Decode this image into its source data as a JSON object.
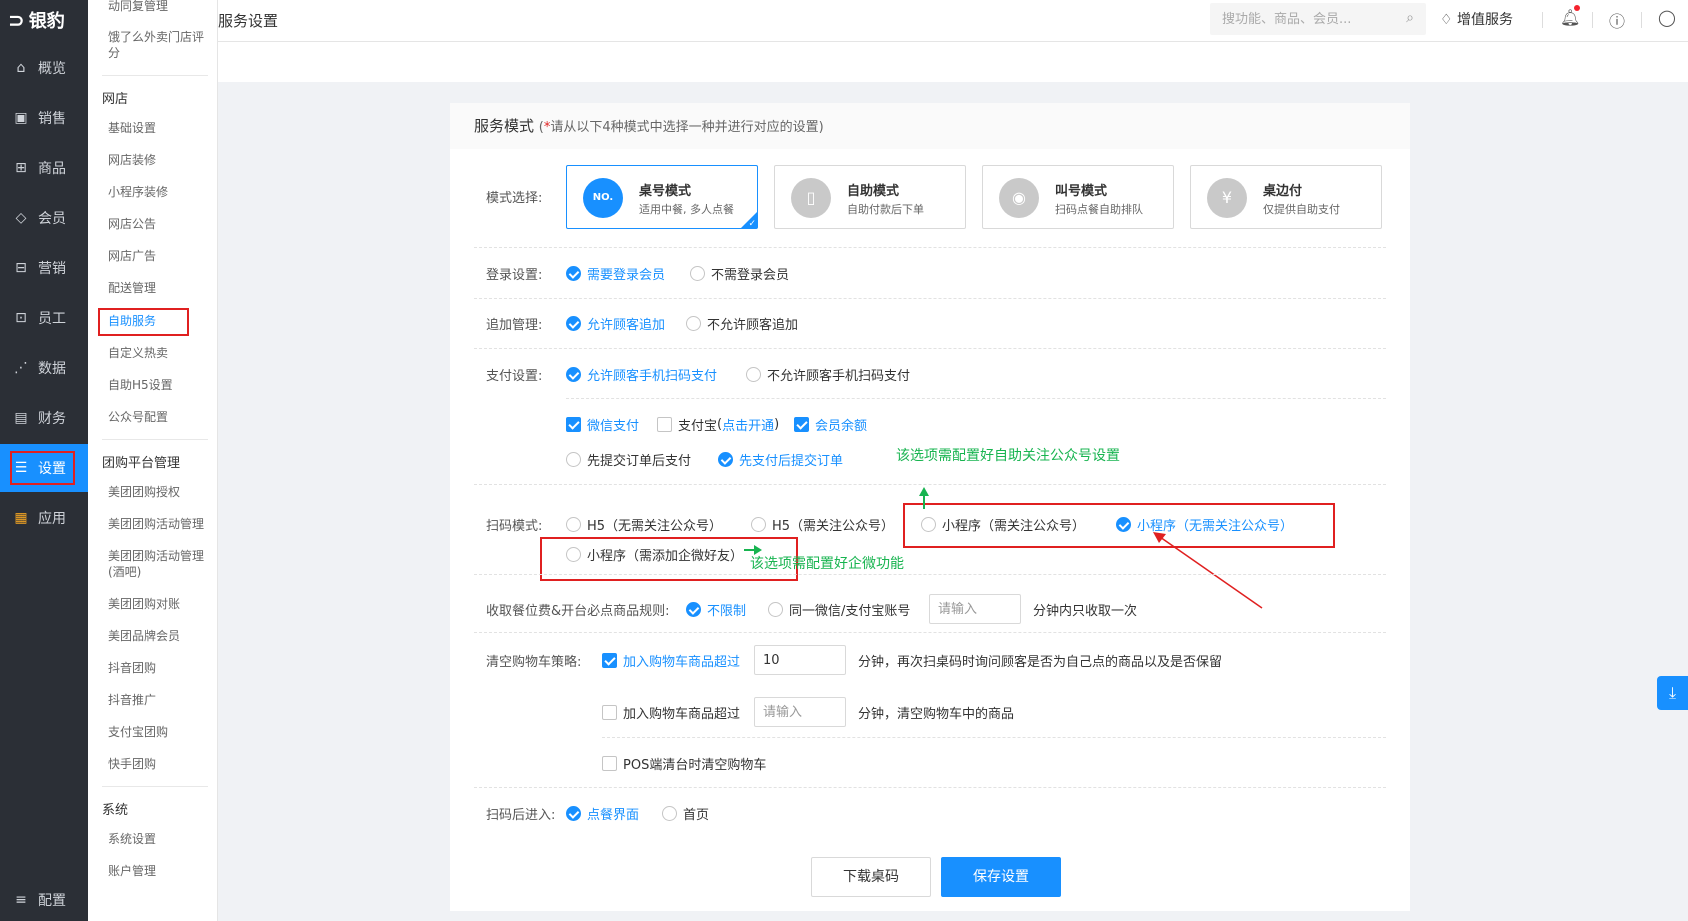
{
  "brand": {
    "name": "银豹",
    "mark": "⊃"
  },
  "nav": [
    {
      "key": "overview",
      "label": "概览",
      "icon": "home-icon",
      "glyph": "⌂"
    },
    {
      "key": "sales",
      "label": "销售",
      "icon": "sales-icon",
      "glyph": "▣"
    },
    {
      "key": "goods",
      "label": "商品",
      "icon": "goods-icon",
      "glyph": "⊞"
    },
    {
      "key": "member",
      "label": "会员",
      "icon": "member-icon",
      "glyph": "◇"
    },
    {
      "key": "marketing",
      "label": "营销",
      "icon": "marketing-icon",
      "glyph": "⊟"
    },
    {
      "key": "staff",
      "label": "员工",
      "icon": "staff-icon",
      "glyph": "⊡"
    },
    {
      "key": "data",
      "label": "数据",
      "icon": "data-icon",
      "glyph": "⋰"
    },
    {
      "key": "finance",
      "label": "财务",
      "icon": "finance-icon",
      "glyph": "▤"
    },
    {
      "key": "settings",
      "label": "设置",
      "icon": "settings-icon",
      "glyph": "☰"
    },
    {
      "key": "apps",
      "label": "应用",
      "icon": "apps-icon",
      "glyph": "▦"
    },
    {
      "key": "config",
      "label": "配置",
      "icon": "config-icon",
      "glyph": "≡"
    }
  ],
  "subnav": {
    "top_items": [
      "动同复管理",
      "饿了么外卖门店评分"
    ],
    "groups": [
      {
        "title": "网店",
        "items": [
          "基础设置",
          "网店装修",
          "小程序装修",
          "网店公告",
          "网店广告",
          "配送管理",
          "自助服务",
          "自定义热卖",
          "自助H5设置",
          "公众号配置"
        ]
      },
      {
        "title": "团购平台管理",
        "items": [
          "美团团购授权",
          "美团团购活动管理",
          "美团团购活动管理(酒吧)",
          "美团团购对账",
          "美团品牌会员",
          "抖音团购",
          "抖音推广",
          "支付宝团购",
          "快手团购"
        ]
      },
      {
        "title": "系统",
        "items": [
          "系统设置",
          "账户管理"
        ]
      }
    ]
  },
  "header": {
    "title": "服务设置",
    "search_placeholder": "搜功能、商品、会员...",
    "value_added": "增值服务"
  },
  "card": {
    "title": "服务模式",
    "note_star": "*",
    "note": "请从以下4种模式中选择一种并进行对应的设置)",
    "note_open": "(",
    "mode_label": "模式选择:",
    "modes": [
      {
        "title": "桌号模式",
        "sub": "适用中餐, 多人点餐",
        "badge": "NO.",
        "selected": true
      },
      {
        "title": "自助模式",
        "sub": "自助付款后下单",
        "badge": "▯",
        "selected": false
      },
      {
        "title": "叫号模式",
        "sub": "扫码点餐自助排队",
        "badge": "🔔",
        "selected": false
      },
      {
        "title": "桌边付",
        "sub": "仅提供自助支付",
        "badge": "¥",
        "selected": false
      }
    ],
    "login": {
      "label": "登录设置:",
      "opt1": "需要登录会员",
      "opt2": "不需登录会员"
    },
    "append": {
      "label": "追加管理:",
      "opt1": "允许顾客追加",
      "opt2": "不允许顾客追加"
    },
    "pay": {
      "label": "支付设置:",
      "opt1": "允许顾客手机扫码支付",
      "opt2": "不允许顾客手机扫码支付",
      "wechat": "微信支付",
      "alipay": "支付宝",
      "alipay_link_open": "(",
      "alipay_link": "点击开通",
      "alipay_link_close": ")",
      "balance": "会员余额",
      "order_first": "先提交订单后支付",
      "pay_first": "先支付后提交订单"
    },
    "scan": {
      "label": "扫码模式:",
      "h5_no": "H5（无需关注公众号）",
      "h5_yes": "H5（需关注公众号）",
      "mp_yes": "小程序（需关注公众号）",
      "mp_no": "小程序（无需关注公众号）",
      "mp_wecom": "小程序（需添加企微好友）"
    },
    "annotations": {
      "top": "该选项需配置好自助关注公众号设置",
      "bottom": "该选项需配置好企微功能"
    },
    "fee": {
      "label": "收取餐位费&开台必点商品规则:",
      "opt1": "不限制",
      "opt2": "同一微信/支付宝账号",
      "placeholder": "请输入",
      "suffix": "分钟内只收取一次"
    },
    "cart": {
      "label": "清空购物车策略:",
      "c1": "加入购物车商品超过",
      "c1_value": "10",
      "c1_suffix": "分钟，再次扫桌码时询问顾客是否为自己点的商品以及是否保留",
      "c2": "加入购物车商品超过",
      "c2_placeholder": "请输入",
      "c2_suffix": "分钟，清空购物车中的商品",
      "c3": "POS端清台时清空购物车"
    },
    "after_scan": {
      "label": "扫码后进入:",
      "opt1": "点餐界面",
      "opt2": "首页"
    },
    "buttons": {
      "download": "下载桌码",
      "save": "保存设置"
    }
  },
  "colors": {
    "primary": "#1890ff",
    "nav_bg": "#2b2f36",
    "annotation": "#18b450",
    "highlight": "#e02020"
  }
}
